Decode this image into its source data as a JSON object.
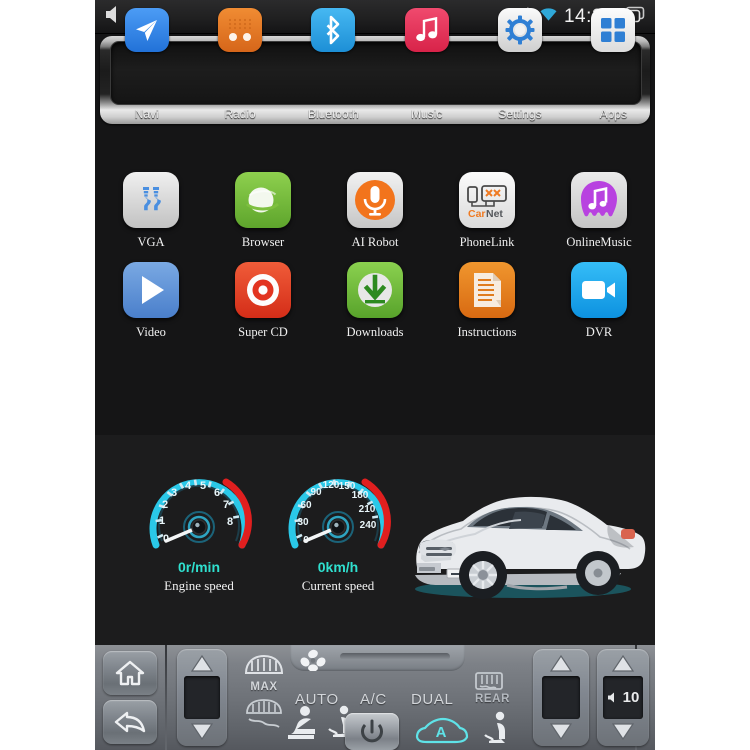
{
  "statusbar": {
    "volume_icon": "speaker-icon",
    "car_icon": "car-icon",
    "bluetooth_icon": "bluetooth-icon",
    "wifi_icon": "wifi-icon",
    "time": "14:28",
    "recents_icon": "recents-icon",
    "accent_wifi": "#2fa8d8"
  },
  "dock": {
    "items": [
      {
        "label": "Navi",
        "icon": "navi-icon",
        "color": "#2f86e8"
      },
      {
        "label": "Radio",
        "icon": "radio-icon",
        "color": "#e8751f"
      },
      {
        "label": "Bluetooth",
        "icon": "bluetooth-icon",
        "color": "#30a6e8"
      },
      {
        "label": "Music",
        "icon": "music-icon",
        "color": "#e63a5e"
      },
      {
        "label": "Settings",
        "icon": "settings-gear-icon",
        "color": "#e8e8e8"
      },
      {
        "label": "Apps",
        "icon": "apps-grid-icon",
        "color": "#f2f2f2"
      }
    ]
  },
  "apps": {
    "rows": [
      [
        {
          "label": "VGA",
          "icon": "vga-connector-icon",
          "color": "#d7d7d7"
        },
        {
          "label": "Browser",
          "icon": "browser-globe-icon",
          "color": "#76c043"
        },
        {
          "label": "AI Robot",
          "icon": "microphone-icon",
          "color": "#d9d9d9"
        },
        {
          "label": "PhoneLink",
          "icon": "carnet-icon",
          "color": "#ededed"
        },
        {
          "label": "OnlineMusic",
          "icon": "online-music-icon",
          "color": "#d9d9d9"
        }
      ],
      [
        {
          "label": "Video",
          "icon": "video-play-icon",
          "color": "#5e93d8"
        },
        {
          "label": "Super CD",
          "icon": "cd-disc-icon",
          "color": "#e8402a"
        },
        {
          "label": "Downloads",
          "icon": "download-arrow-icon",
          "color": "#6ec13e"
        },
        {
          "label": "Instructions",
          "icon": "document-icon",
          "color": "#e8841f"
        },
        {
          "label": "DVR",
          "icon": "dvr-camera-icon",
          "color": "#1eaaf0"
        }
      ]
    ]
  },
  "carinfo": {
    "tach": {
      "value": "0r/min",
      "label": "Engine speed",
      "ticks": [
        "0",
        "1",
        "2",
        "3",
        "4",
        "5",
        "6",
        "7",
        "8"
      ],
      "redline_from": "7",
      "needle_at": "0"
    },
    "speedo": {
      "value": "0km/h",
      "label": "Current speed",
      "ticks": [
        "0",
        "30",
        "60",
        "90",
        "120",
        "150",
        "180",
        "210",
        "240"
      ],
      "redline_from": "180",
      "needle_at": "0"
    },
    "vehicle_image": "hyundai-suv-silver",
    "accent": "#2fe0cf"
  },
  "hardware": {
    "home_icon": "home-icon",
    "back_icon": "back-arrow-icon",
    "left_rocker": {
      "up_icon": "chevron-up-icon",
      "down_icon": "chevron-down-icon",
      "display": ""
    },
    "defrost_front_icon": "front-defrost-icon",
    "defrost_front_label": "MAX",
    "defrost_rear_small_icon": "rear-defrost-small-icon",
    "seat_front_icon": "seat-front-icon",
    "seat_driver_icon": "seat-driver-icon",
    "fan_icon": "fan-icon",
    "labels": [
      "AUTO",
      "A/C",
      "DUAL",
      "REAR"
    ],
    "rear_defrost_icon": "rear-defrost-icon",
    "power_icon": "power-icon",
    "recirculate_icon": "auto-recirculation-icon",
    "recirculate_letter": "A",
    "seat_rear_icon": "seat-rear-icon",
    "temp_rocker": {
      "up_icon": "chevron-up-icon",
      "down_icon": "chevron-down-icon",
      "display": ""
    },
    "volume_rocker": {
      "up_icon": "chevron-up-icon",
      "down_icon": "chevron-down-icon",
      "speaker_icon": "speaker-small-icon",
      "display": "10"
    }
  }
}
